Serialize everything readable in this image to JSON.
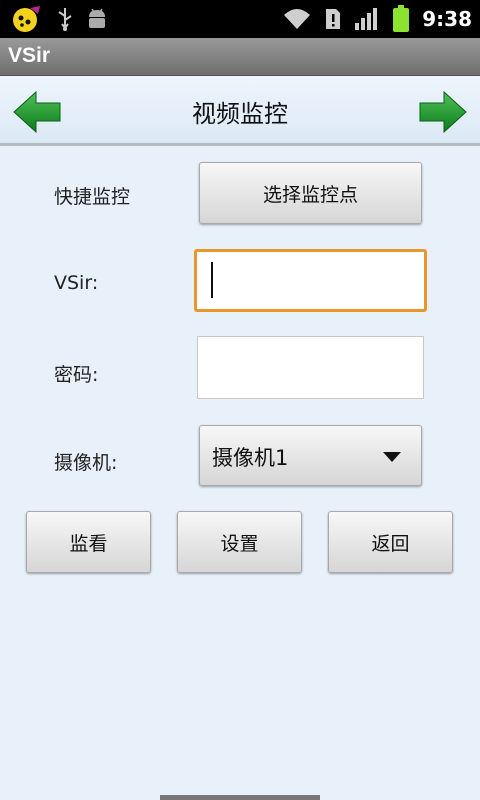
{
  "status_bar": {
    "time": "9:38"
  },
  "app": {
    "title": "VSir"
  },
  "header": {
    "title": "视频监控"
  },
  "form": {
    "quick_label": "快捷监控",
    "select_point_button": "选择监控点",
    "vsir_label": "VSir:",
    "vsir_value": "",
    "password_label": "密码:",
    "password_value": "",
    "camera_label": "摄像机:",
    "camera_selected": "摄像机1"
  },
  "actions": {
    "watch": "监看",
    "settings": "设置",
    "back": "返回"
  },
  "colors": {
    "focus_border": "#e9962b",
    "arrow_green": "#1f9a2e",
    "battery_green": "#8be22f"
  }
}
